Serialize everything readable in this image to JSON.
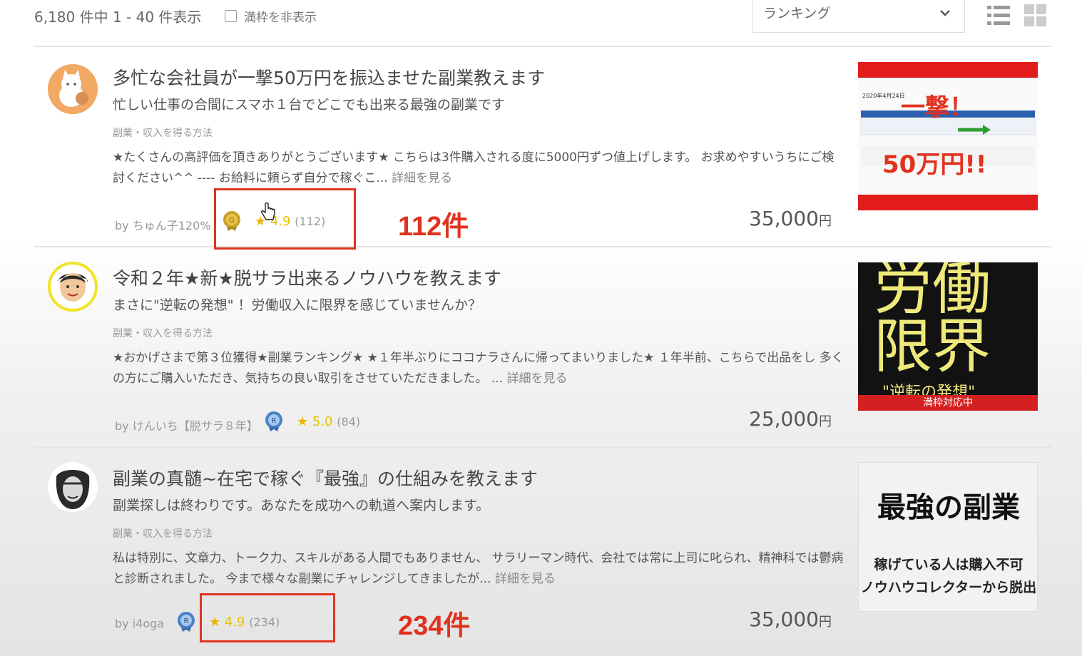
{
  "header": {
    "result_count": "6,180 件中 1 - 40 件表示",
    "hide_full_label": "満枠を非表示",
    "sort_selected": "ランキング"
  },
  "items": [
    {
      "title": "多忙な会社員が一撃50万円を振込ませた副業教えます",
      "subtitle": "忙しい仕事の合間にスマホ１台でどこでも出来る最強の副業です",
      "category": "副業・収入を得る方法",
      "description": "★たくさんの高評価を頂きありがとうございます★ こちらは3件購入される度に5000円ずつ値上げします。 お求めやすいうちにご検討ください^^ ---- お給料に頼らず自分で稼ぐこ...",
      "more": "詳細を見る",
      "seller": "by ちゅん子120%",
      "rating_score": "4.9",
      "rating_count": "(112)",
      "price": "35,000",
      "price_unit": "円",
      "annotation": "112件",
      "thumb": {
        "date": "2020年4月24日",
        "headline": "一撃！",
        "amount": "50万円!!"
      }
    },
    {
      "title": "令和２年★新★脱サラ出来るノウハウを教えます",
      "subtitle": "まさに\"逆転の発想\" ！労働収入に限界を感じていませんか？",
      "category": "副業・収入を得る方法",
      "description": "★おかげさまで第３位獲得★副業ランキング★ ★１年半ぶりにココナラさんに帰ってまいりました★ １年半前、こちらで出品をし 多くの方にご購入いただき、気持ちの良い取引をさせていただきました。 ...",
      "more": "詳細を見る",
      "seller": "by けんいち【脱サラ８年】",
      "rating_score": "5.0",
      "rating_count": "(84)",
      "price": "25,000",
      "price_unit": "円",
      "thumb": {
        "line1": "労働",
        "line2": "限界",
        "line3": "\"逆転の発想\"",
        "banner": "満枠対応中"
      }
    },
    {
      "title": "副業の真髄~在宅で稼ぐ『最強』の仕組みを教えます",
      "subtitle": "副業探しは終わりです。あなたを成功への軌道へ案内します。",
      "category": "副業・収入を得る方法",
      "description": "私は特別に、文章力、トーク力、スキルがある人間でもありません、 サラリーマン時代、会社では常に上司に叱られ、精神科では鬱病と診断されました。 今まで様々な副業にチャレンジしてきましたが...",
      "more": "詳細を見る",
      "seller": "by i4oga",
      "rating_score": "4.9",
      "rating_count": "(234)",
      "price": "35,000",
      "price_unit": "円",
      "annotation": "234件",
      "thumb": {
        "line1": "最強の副業",
        "line2": "稼げている人は購入不可",
        "line3": "ノウハウコレクターから脱出"
      }
    }
  ]
}
